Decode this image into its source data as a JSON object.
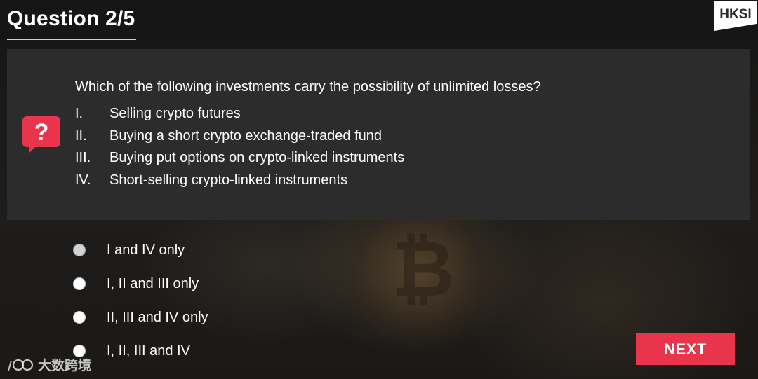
{
  "header": {
    "title": "Question 2/5",
    "logo_text": "HKSI"
  },
  "question": {
    "icon": "question-mark-icon",
    "text": "Which of the following investments carry the possibility of unlimited losses?",
    "statements": [
      {
        "num": "I.",
        "text": "Selling crypto futures"
      },
      {
        "num": "II.",
        "text": "Buying a short crypto exchange-traded fund"
      },
      {
        "num": "III.",
        "text": "Buying put options on crypto-linked instruments"
      },
      {
        "num": "IV.",
        "text": "Short-selling crypto-linked instruments"
      }
    ]
  },
  "options": [
    {
      "label": "I and IV only"
    },
    {
      "label": "I, II and III only"
    },
    {
      "label": "II, III and IV only"
    },
    {
      "label": "I, II, III and IV"
    }
  ],
  "next_button": {
    "label": "NEXT"
  },
  "watermark": {
    "text": "大数跨境"
  },
  "colors": {
    "accent": "#e8354b",
    "panel": "#2c2c2c",
    "text": "#ffffff"
  }
}
